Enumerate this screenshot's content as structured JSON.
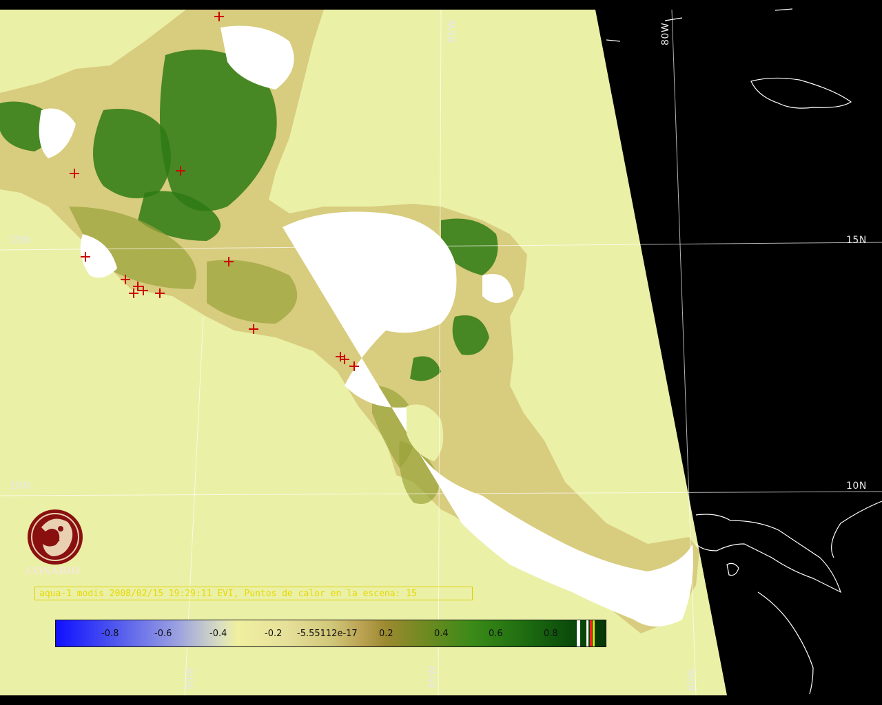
{
  "map": {
    "graticule": {
      "lon_labels_top": [
        "85W",
        "80W"
      ],
      "lon_labels_bottom": [
        "90W",
        "85W",
        "80W"
      ],
      "lat_labels_left": [
        "15N",
        "10N"
      ],
      "lat_labels_right": [
        "15N",
        "10N"
      ]
    },
    "colors": {
      "ocean": "#eaf0a6",
      "background": "#000000",
      "cloud": "#ffffff",
      "vegetation_low": "#d8cc7e",
      "vegetation_mid": "#9aa23a",
      "vegetation_high": "#2e7a14",
      "fire_marker": "#cc0000",
      "coastline_outside": "#ffffff",
      "grid": "#ffffff"
    },
    "fire_marker_count": 14
  },
  "logo": {
    "text": "CONABIO",
    "icon": "conabio-logo-icon"
  },
  "caption": {
    "text": "aqua-1 modis 2008/02/15 19:29:11 EVI, Puntos de calor en la escena: 15"
  },
  "colorbar": {
    "ticks": [
      "-0.8",
      "-0.6",
      "-0.4",
      "-0.2",
      "-5.55112e-17",
      "0.2",
      "0.4",
      "0.6",
      "0.8"
    ]
  }
}
